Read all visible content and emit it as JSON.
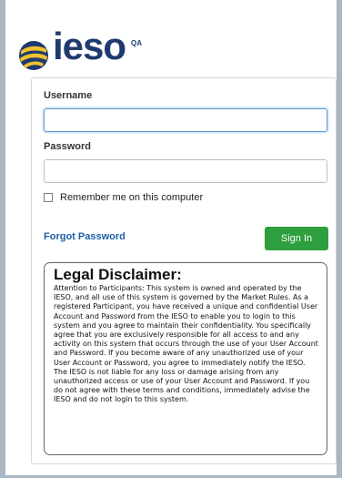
{
  "brand": {
    "name": "ieso",
    "env_tag": "QA",
    "color": "#1e3a6e"
  },
  "login": {
    "username_label": "Username",
    "username_value": "",
    "password_label": "Password",
    "password_value": "",
    "remember_label": "Remember me on this computer",
    "remember_checked": false,
    "forgot_password": "Forgot Password",
    "sign_in": "Sign In",
    "sign_in_color": "#2e9e3e"
  },
  "disclaimer": {
    "title": "Legal Disclaimer:",
    "body": "Attention to Participants: This system is owned and operated by the IESO, and all use of this system is governed by the Market Rules. As a registered Participant, you have received a unique and confidential User Account and Password from the IESO to enable you to login to this system and you agree to maintain their confidentiality. You specifically agree that you are exclusively responsible for all access to and any activity on this system that occurs through the use of your User Account and Password. If you become aware of any unauthorized use of your User Account or Password, you agree to immediately notify the IESO. The IESO is not liable for any loss or damage arising from any unauthorized access or use of your User Account and Password. If you do not agree with these terms and conditions, immediately advise the IESO and do not login to this system."
  },
  "icons": {
    "logo": "ieso-globe-logo-icon",
    "checkbox": "checkbox-icon"
  }
}
